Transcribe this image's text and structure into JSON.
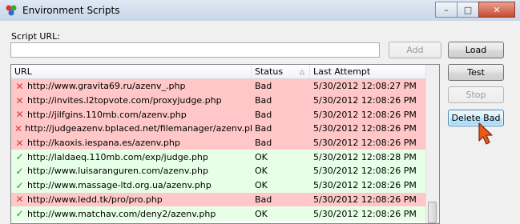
{
  "window": {
    "title": "Environment Scripts",
    "controls": {
      "minimize": "–",
      "maximize": "□",
      "close": "✕"
    }
  },
  "form": {
    "url_label": "Script URL:",
    "url_value": "",
    "add_label": "Add"
  },
  "buttons": {
    "load": "Load",
    "test": "Test",
    "stop": "Stop",
    "delete_bad": "Delete Bad"
  },
  "list": {
    "columns": {
      "url": "URL",
      "status": "Status",
      "last_attempt": "Last Attempt"
    },
    "sort_icon": "sort-ascending-icon",
    "rows": [
      {
        "url": "http://www.gravita69.ru/azenv_.php",
        "status": "Bad",
        "last_attempt": "5/30/2012 12:08:27 PM",
        "state": "bad"
      },
      {
        "url": "http://invites.l2topvote.com/proxyjudge.php",
        "status": "Bad",
        "last_attempt": "5/30/2012 12:08:26 PM",
        "state": "bad"
      },
      {
        "url": "http://jilfgins.110mb.com/azenv.php",
        "status": "Bad",
        "last_attempt": "5/30/2012 12:08:26 PM",
        "state": "bad"
      },
      {
        "url": "http://judgeazenv.bplaced.net/filemanager/azenv.php",
        "status": "Bad",
        "last_attempt": "5/30/2012 12:08:26 PM",
        "state": "bad"
      },
      {
        "url": "http://kaoxis.iespana.es/azenv.php",
        "status": "Bad",
        "last_attempt": "5/30/2012 12:08:26 PM",
        "state": "bad"
      },
      {
        "url": "http://laldaeq.110mb.com/exp/judge.php",
        "status": "OK",
        "last_attempt": "5/30/2012 12:08:28 PM",
        "state": "ok"
      },
      {
        "url": "http://www.luisaranguren.com/azenv.php",
        "status": "OK",
        "last_attempt": "5/30/2012 12:08:26 PM",
        "state": "ok"
      },
      {
        "url": "http://www.massage-ltd.org.ua/azenv.php",
        "status": "OK",
        "last_attempt": "5/30/2012 12:08:26 PM",
        "state": "ok"
      },
      {
        "url": "http://www.ledd.tk/pro/pro.php",
        "status": "Bad",
        "last_attempt": "5/30/2012 12:08:26 PM",
        "state": "bad"
      },
      {
        "url": "http://www.matchav.com/deny2/azenv.php",
        "status": "OK",
        "last_attempt": "5/30/2012 12:08:26 PM",
        "state": "ok"
      }
    ]
  },
  "colors": {
    "bad_row": "#ffc7c7",
    "ok_row": "#e6ffe6",
    "focus_accent": "#3c7fb1"
  }
}
